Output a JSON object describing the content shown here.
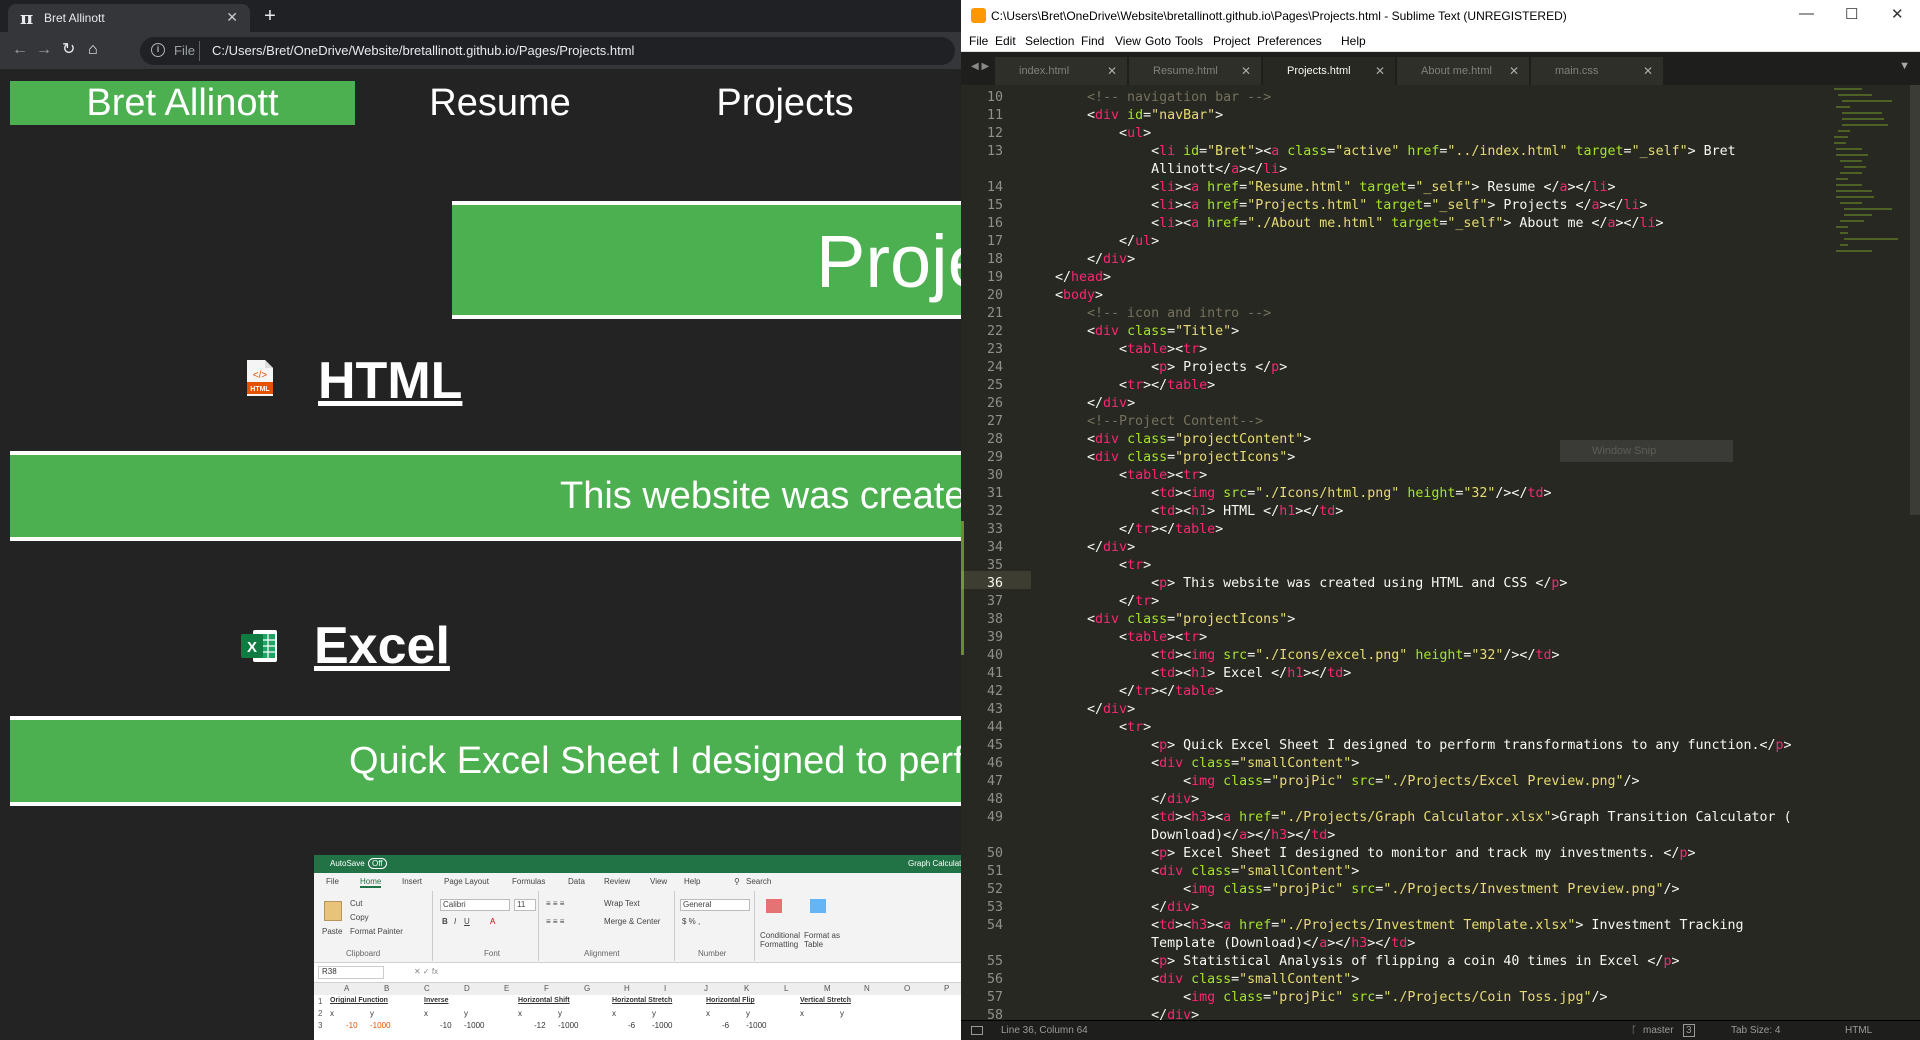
{
  "browser": {
    "tab_title": "Bret Allinott",
    "tab_icon": "pi-icon",
    "scheme": "File",
    "url": "C:/Users/Bret/OneDrive/Website/bretallinott.github.io/Pages/Projects.html"
  },
  "site": {
    "nav": {
      "brand": "Bret Allinott",
      "resume": "Resume",
      "projects": "Projects"
    },
    "title_text": "Proje",
    "projects": [
      {
        "heading": "HTML",
        "description": "This website was create"
      },
      {
        "heading": "Excel",
        "description": "Quick Excel Sheet I designed to perfo"
      }
    ],
    "excel_preview": {
      "title": "Graph Calculat",
      "autosave": "AutoSave",
      "autosave_state": "Off",
      "menu": [
        "File",
        "Home",
        "Insert",
        "Page Layout",
        "Formulas",
        "Data",
        "Review",
        "View",
        "Help",
        "Search"
      ],
      "ribbon": {
        "paste": "Paste",
        "cut": "Cut",
        "copy": "Copy",
        "format_painter": "Format Painter",
        "clipboard": "Clipboard",
        "font_name": "Calibri",
        "font_size": "11",
        "font": "Font",
        "wrap_text": "Wrap Text",
        "merge_center": "Merge & Center",
        "alignment": "Alignment",
        "number_format": "General",
        "number": "Number",
        "conditional": "Conditional Formatting",
        "format_table": "Format as Table"
      },
      "name_box": "R38",
      "columns": [
        "A",
        "B",
        "C",
        "D",
        "E",
        "F",
        "G",
        "H",
        "I",
        "J",
        "K",
        "L",
        "M",
        "N",
        "O",
        "P"
      ],
      "row_numbers": [
        "1",
        "2",
        "3"
      ],
      "headers": [
        "Original Function",
        "Inverse",
        "Horizontal Shift",
        "Horizontal Stretch",
        "Horizontal Flip",
        "Vertical Stretch"
      ],
      "xy": [
        "x",
        "y"
      ],
      "row3": [
        "-10",
        "-1000",
        "-10",
        "-1000",
        "-12",
        "-1000",
        "-6",
        "-1000",
        "-6",
        "-1000"
      ]
    }
  },
  "editor": {
    "window_title": "C:\\Users\\Bret\\OneDrive\\Website\\bretallinott.github.io\\Pages\\Projects.html - Sublime Text (UNREGISTERED)",
    "menu": [
      "File",
      "Edit",
      "Selection",
      "Find",
      "View",
      "Goto",
      "Tools",
      "Project",
      "Preferences",
      "Help"
    ],
    "tabs": [
      "index.html",
      "Resume.html",
      "Projects.html",
      "About me.html",
      "main.css"
    ],
    "active_tab": "Projects.html",
    "tooltip": "Window Snip",
    "line_numbers": [
      "10",
      "11",
      "12",
      "13",
      "",
      "14",
      "15",
      "16",
      "17",
      "18",
      "19",
      "20",
      "21",
      "22",
      "23",
      "24",
      "25",
      "26",
      "27",
      "28",
      "29",
      "30",
      "31",
      "32",
      "33",
      "34",
      "35",
      "36",
      "37",
      "38",
      "39",
      "40",
      "41",
      "42",
      "43",
      "44",
      "45",
      "46",
      "47",
      "48",
      "49",
      "",
      "50",
      "51",
      "52",
      "53",
      "54",
      "",
      "55",
      "56",
      "57",
      "58"
    ],
    "current_line": "36",
    "lines": [
      "    <!-- navigation bar -->",
      "    <div id=\"navBar\">",
      "        <ul>",
      "            <li id=\"Bret\"><a class=\"active\" href=\"../index.html\" target=\"_self\"> Bret",
      "            Allinott</a></li>",
      "            <li><a href=\"Resume.html\" target=\"_self\"> Resume </a></li>",
      "            <li><a href=\"Projects.html\" target=\"_self\"> Projects </a></li>",
      "            <li><a href=\"./About me.html\" target=\"_self\"> About me </a></li>",
      "        </ul>",
      "    </div>",
      "</head>",
      "<body>",
      "    <!-- icon and intro -->",
      "    <div class=\"Title\">",
      "        <table><tr>",
      "            <p> Projects </p>",
      "        <tr></table>",
      "    </div>",
      "    <!--Project Content-->",
      "    <div class=\"projectContent\">",
      "    <div class=\"projectIcons\">",
      "        <table><tr>",
      "            <td><img src=\"./Icons/html.png\" height=\"32\"/></td>",
      "            <td><h1> HTML </h1></td>",
      "        </tr></table>",
      "    </div>",
      "        <tr>",
      "            <p> This website was created using HTML and CSS </p>",
      "        </tr>",
      "    <div class=\"projectIcons\">",
      "        <table><tr>",
      "            <td><img src=\"./Icons/excel.png\" height=\"32\"/></td>",
      "            <td><h1> Excel </h1></td>",
      "        </tr></table>",
      "    </div>",
      "        <tr>",
      "            <p> Quick Excel Sheet I designed to perform transformations to any function.</p>",
      "            <div class=\"smallContent\">",
      "                <img class=\"projPic\" src=\"./Projects/Excel Preview.png\"/>",
      "            </div>",
      "            <td><h3><a href=\"./Projects/Graph Calculator.xlsx\">Graph Transition Calculator (",
      "            Download)</a></h3></td>",
      "            <p> Excel Sheet I designed to monitor and track my investments. </p>",
      "            <div class=\"smallContent\">",
      "                <img class=\"projPic\" src=\"./Projects/Investment Preview.png\"/>",
      "            </div>",
      "            <td><h3><a href=\"./Projects/Investment Template.xlsx\"> Investment Tracking",
      "            Template (Download)</a></h3></td>",
      "            <p> Statistical Analysis of flipping a coin 40 times in Excel </p>",
      "            <div class=\"smallContent\">",
      "                <img class=\"projPic\" src=\"./Projects/Coin Toss.jpg\"/>",
      "            </div>"
    ],
    "status": {
      "position": "Line 36, Column 64",
      "branch": "master",
      "branch_count": "3",
      "tab_size": "Tab Size: 4",
      "syntax": "HTML"
    }
  },
  "colors": {
    "green": "#4caf50",
    "monokai_bg": "#272822",
    "tag": "#f92672",
    "attr": "#a6e22e",
    "string": "#e6db74",
    "comment": "#75715e"
  }
}
